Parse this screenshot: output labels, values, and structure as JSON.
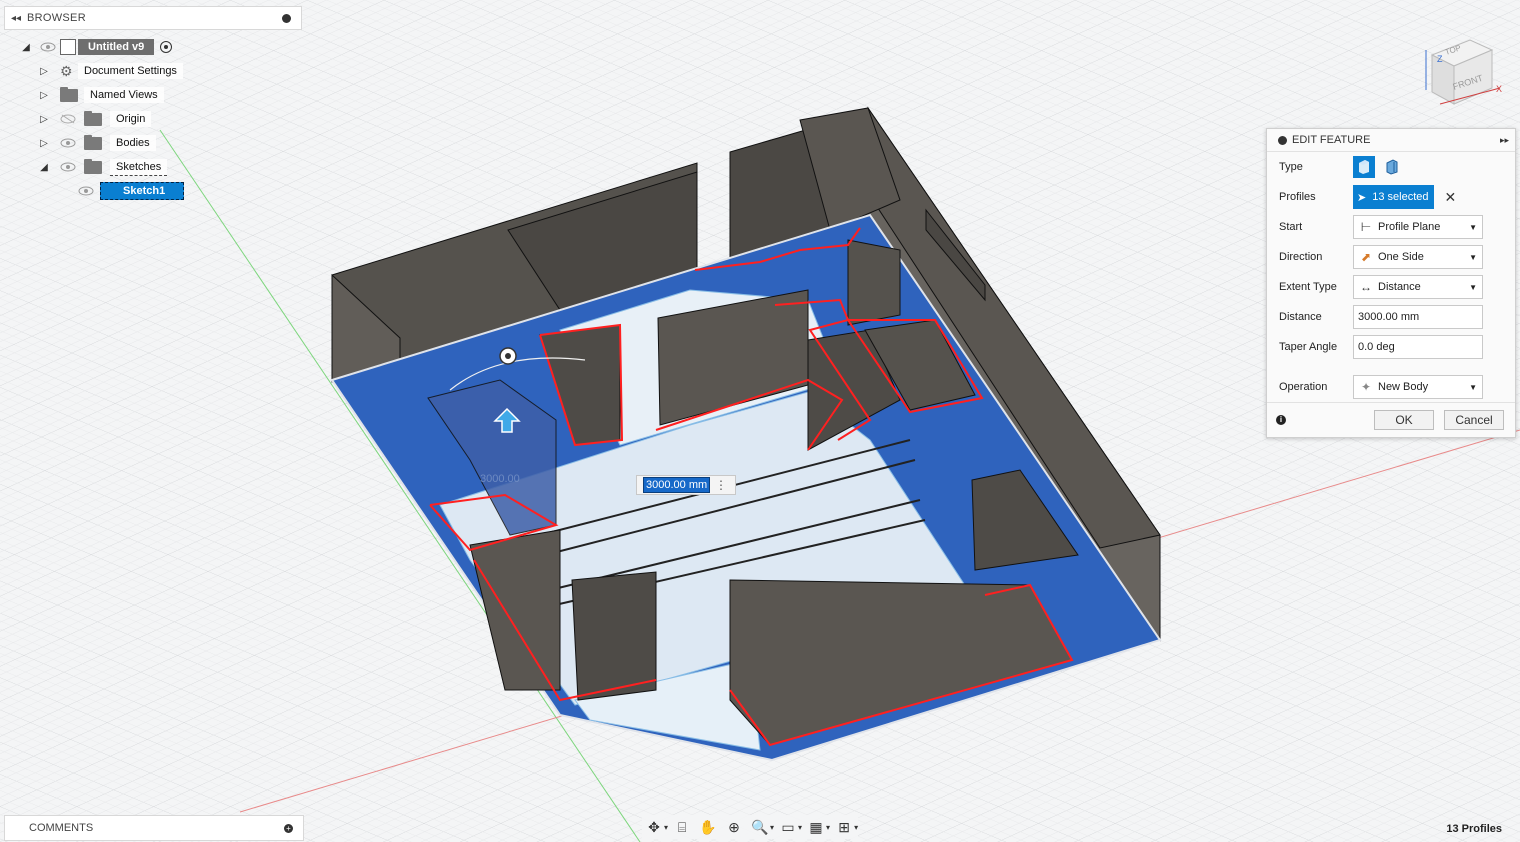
{
  "browser": {
    "title": "BROWSER",
    "items": [
      {
        "label": "Untitled v9"
      },
      {
        "label": "Document Settings"
      },
      {
        "label": "Named Views"
      },
      {
        "label": "Origin"
      },
      {
        "label": "Bodies"
      },
      {
        "label": "Sketches"
      },
      {
        "label": "Sketch1"
      }
    ]
  },
  "comments": {
    "title": "COMMENTS"
  },
  "edit_feature": {
    "title": "EDIT FEATURE",
    "rows": {
      "type": {
        "label": "Type"
      },
      "profiles": {
        "label": "Profiles",
        "value": "13 selected"
      },
      "start": {
        "label": "Start",
        "value": "Profile Plane"
      },
      "direction": {
        "label": "Direction",
        "value": "One Side"
      },
      "extent_type": {
        "label": "Extent Type",
        "value": "Distance"
      },
      "distance": {
        "label": "Distance",
        "value": "3000.00 mm"
      },
      "taper_angle": {
        "label": "Taper Angle",
        "value": "0.0 deg"
      },
      "operation": {
        "label": "Operation",
        "value": "New Body"
      }
    },
    "ok_label": "OK",
    "cancel_label": "Cancel"
  },
  "canvas": {
    "dimension_value": "3000.00 mm",
    "ghost_dimension": "3000.00",
    "viewcube": {
      "top": "TOP",
      "front": "FRONT",
      "x": "X",
      "z": "Z"
    }
  },
  "status": {
    "profiles": "13 Profiles"
  },
  "colors": {
    "accent": "#0a7fd1",
    "profile_fill": "#2f63bd",
    "wall": "#5e5a55",
    "outline": "#ff2020"
  }
}
